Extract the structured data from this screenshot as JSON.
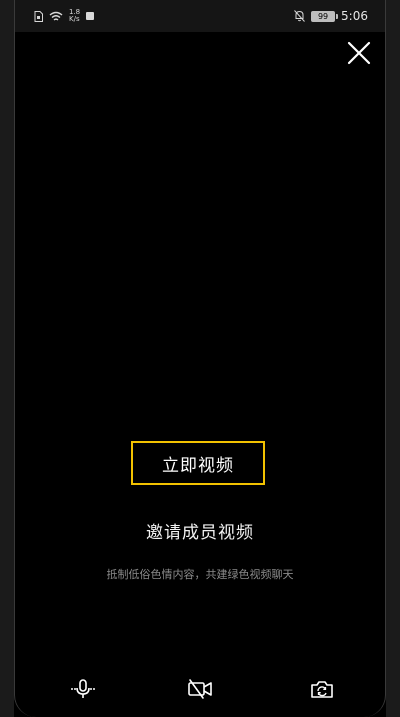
{
  "status_bar": {
    "net_speed_value": "1.8",
    "net_speed_unit": "K/s",
    "battery": "99",
    "time": "5:06"
  },
  "main": {
    "video_button_label": "立即视频",
    "invite_title": "邀请成员视频",
    "hint": "抵制低俗色情内容，共建绿色视频聊天"
  },
  "icons": {
    "close": "close-icon",
    "microphone": "microphone-icon",
    "camera_off": "camera-off-icon",
    "switch_camera": "switch-camera-icon"
  },
  "colors": {
    "accent": "#f2c200",
    "background": "#000000",
    "hint": "#8a8a8a"
  }
}
